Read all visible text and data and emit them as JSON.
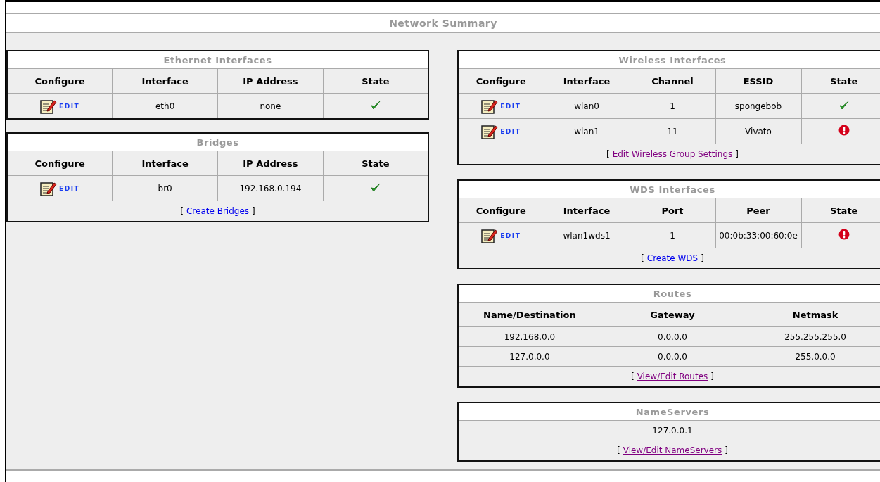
{
  "title": "Network Summary",
  "left": [
    {
      "title": "Ethernet Interfaces",
      "columns": [
        "Configure",
        "Interface",
        "IP Address",
        "State"
      ],
      "rows": [
        [
          {
            "kind": "edit",
            "text": "EDIT"
          },
          {
            "kind": "text",
            "text": "eth0"
          },
          {
            "kind": "text",
            "text": "none"
          },
          {
            "kind": "state",
            "ok": true
          }
        ]
      ]
    },
    {
      "title": "Bridges",
      "columns": [
        "Configure",
        "Interface",
        "IP Address",
        "State"
      ],
      "rows": [
        [
          {
            "kind": "edit",
            "text": "EDIT"
          },
          {
            "kind": "text",
            "text": "br0"
          },
          {
            "kind": "text",
            "text": "192.168.0.194"
          },
          {
            "kind": "state",
            "ok": true
          }
        ]
      ],
      "footer": {
        "open": "[",
        "link": "Create Bridges",
        "visited": false,
        "close": "]"
      }
    }
  ],
  "right": [
    {
      "title": "Wireless Interfaces",
      "columns": [
        "Configure",
        "Interface",
        "Channel",
        "ESSID",
        "State"
      ],
      "rows": [
        [
          {
            "kind": "edit",
            "text": "EDIT"
          },
          {
            "kind": "text",
            "text": "wlan0"
          },
          {
            "kind": "text",
            "text": "1"
          },
          {
            "kind": "text",
            "text": "spongebob"
          },
          {
            "kind": "state",
            "ok": true
          }
        ],
        [
          {
            "kind": "edit",
            "text": "EDIT"
          },
          {
            "kind": "text",
            "text": "wlan1"
          },
          {
            "kind": "text",
            "text": "11"
          },
          {
            "kind": "text",
            "text": "Vivato"
          },
          {
            "kind": "state",
            "ok": false
          }
        ]
      ],
      "footer": {
        "open": "[",
        "link": "Edit Wireless Group Settings",
        "visited": true,
        "close": "]"
      }
    },
    {
      "title": "WDS Interfaces",
      "columns": [
        "Configure",
        "Interface",
        "Port",
        "Peer",
        "State"
      ],
      "rows": [
        [
          {
            "kind": "edit",
            "text": "EDIT"
          },
          {
            "kind": "text",
            "text": "wlan1wds1"
          },
          {
            "kind": "text",
            "text": "1"
          },
          {
            "kind": "text",
            "text": "00:0b:33:00:60:0e"
          },
          {
            "kind": "state",
            "ok": false
          }
        ]
      ],
      "footer": {
        "open": "[",
        "link": "Create WDS",
        "visited": false,
        "close": "]"
      }
    },
    {
      "title": "Routes",
      "columns": [
        "Name/Destination",
        "Gateway",
        "Netmask"
      ],
      "rows": [
        [
          {
            "kind": "text",
            "text": "192.168.0.0"
          },
          {
            "kind": "text",
            "text": "0.0.0.0"
          },
          {
            "kind": "text",
            "text": "255.255.255.0"
          }
        ],
        [
          {
            "kind": "text",
            "text": "127.0.0.0"
          },
          {
            "kind": "text",
            "text": "0.0.0.0"
          },
          {
            "kind": "text",
            "text": "255.0.0.0"
          }
        ]
      ],
      "footer": {
        "open": "[",
        "link": "View/Edit Routes",
        "visited": true,
        "close": "]"
      }
    },
    {
      "title": "NameServers",
      "rows": [
        [
          {
            "kind": "text",
            "text": "127.0.0.1"
          }
        ]
      ],
      "footer": {
        "open": "[",
        "link": "View/Edit NameServers",
        "visited": true,
        "close": "]"
      }
    }
  ]
}
